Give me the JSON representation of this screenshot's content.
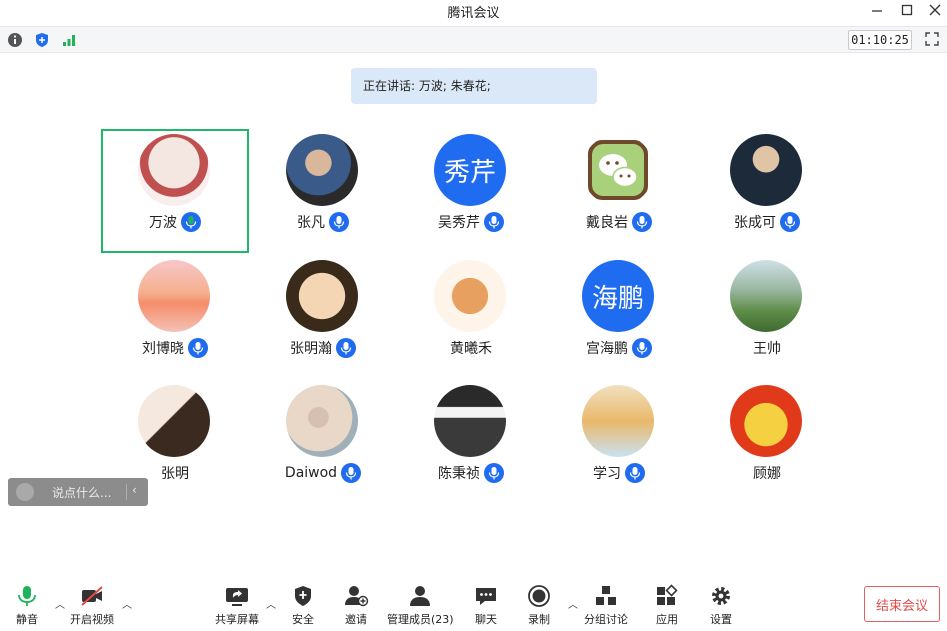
{
  "window": {
    "title": "腾讯会议"
  },
  "infobar": {
    "timer": "01:10:25"
  },
  "speaking": {
    "text": "正在讲话: 万波; 朱春花;"
  },
  "participants": [
    {
      "name": "万波",
      "mic": true,
      "active": true,
      "avatar": "photo"
    },
    {
      "name": "张凡",
      "mic": true,
      "avatar": "photo"
    },
    {
      "name": "吴秀芹",
      "mic": true,
      "avatar": "text",
      "avatar_text": "秀芹"
    },
    {
      "name": "戴良岩",
      "mic": true,
      "avatar": "wechat"
    },
    {
      "name": "张成可",
      "mic": true,
      "avatar": "photo"
    },
    {
      "name": "刘博晓",
      "mic": true,
      "avatar": "photo"
    },
    {
      "name": "张明瀚",
      "mic": true,
      "avatar": "photo"
    },
    {
      "name": "黄曦禾",
      "mic": false,
      "avatar": "photo"
    },
    {
      "name": "宫海鹏",
      "mic": true,
      "avatar": "text",
      "avatar_text": "海鹏"
    },
    {
      "name": "王帅",
      "mic": false,
      "avatar": "photo"
    },
    {
      "name": "张明",
      "mic": false,
      "avatar": "photo"
    },
    {
      "name": "Daiwod",
      "mic": true,
      "avatar": "photo"
    },
    {
      "name": "陈秉祯",
      "mic": true,
      "avatar": "photo"
    },
    {
      "name": "学习",
      "mic": true,
      "avatar": "photo"
    },
    {
      "name": "顾娜",
      "mic": false,
      "avatar": "photo"
    }
  ],
  "chat": {
    "placeholder": "说点什么..."
  },
  "toolbar": {
    "mute": "静音",
    "video": "开启视频",
    "share": "共享屏幕",
    "security": "安全",
    "invite": "邀请",
    "members": "管理成员(23)",
    "chat": "聊天",
    "record": "录制",
    "breakout": "分组讨论",
    "apps": "应用",
    "settings": "设置",
    "end": "结束会议"
  },
  "colors": {
    "accent": "#1f6cf0",
    "active_border": "#20b76a",
    "end": "#e34a4a",
    "mic_green": "#1fb45a"
  }
}
